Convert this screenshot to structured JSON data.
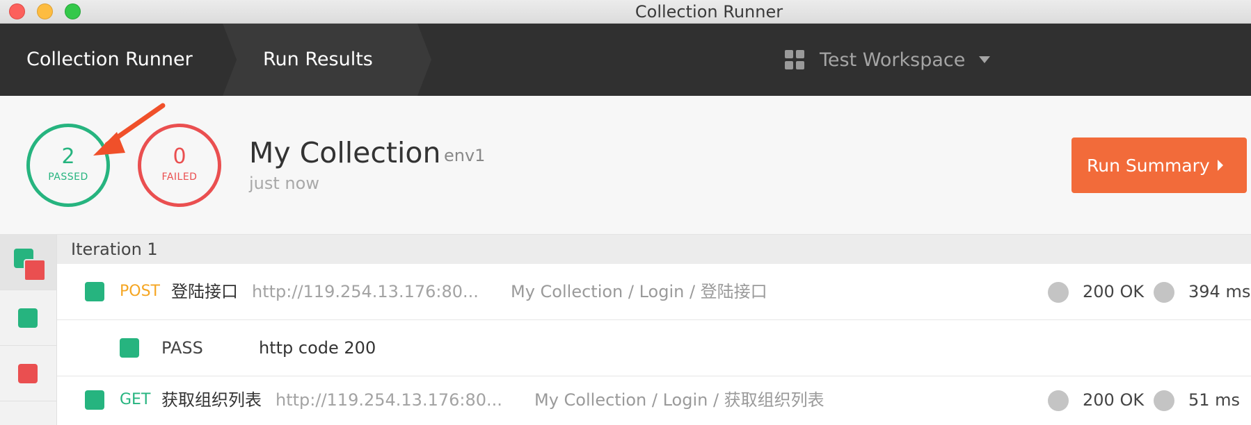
{
  "window": {
    "title": "Collection Runner"
  },
  "nav": {
    "crumbs": [
      "Collection Runner",
      "Run Results"
    ],
    "workspace": "Test Workspace"
  },
  "summary": {
    "passed_count": "2",
    "passed_label": "PASSED",
    "failed_count": "0",
    "failed_label": "FAILED",
    "collection_name": "My Collection",
    "environment": "env1",
    "time": "just now",
    "run_summary_label": "Run Summary"
  },
  "results": {
    "iteration_label": "Iteration 1",
    "requests": [
      {
        "method": "POST",
        "name": "登陆接口",
        "url": "http://119.254.13.176:80...",
        "path": "My Collection / Login / 登陆接口",
        "status": "200 OK",
        "time": "394 ms",
        "passed": true
      },
      {
        "method": "GET",
        "name": "获取组织列表",
        "url": "http://119.254.13.176:80...",
        "path": "My Collection / Login / 获取组织列表",
        "status": "200 OK",
        "time": "51 ms",
        "passed": true
      }
    ],
    "assertions": [
      {
        "result": "PASS",
        "name": "http code 200"
      }
    ]
  },
  "colors": {
    "pass": "#26b47f",
    "fail": "#ea4f50",
    "accent": "#f26b3a",
    "post": "#f5a623",
    "nav_bg": "#303030"
  },
  "icons": [
    "workspace-grid-icon",
    "dropdown-caret-icon",
    "play-triangle-icon",
    "annotation-arrow-icon"
  ]
}
